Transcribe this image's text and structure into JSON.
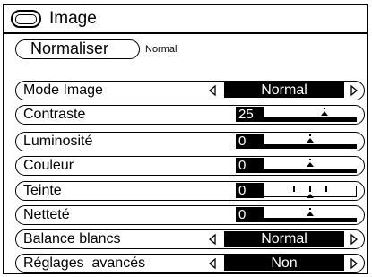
{
  "title": {
    "label": "Image",
    "icon": "screen-icon"
  },
  "normalize": {
    "button_label": "Normaliser",
    "status": "Normal"
  },
  "rows": {
    "mode_image": {
      "label": "Mode Image",
      "value": "Normal"
    },
    "contraste": {
      "label": "Contraste",
      "value": "25",
      "level": 0.65
    },
    "luminosite": {
      "label": "Luminosité",
      "value": "0",
      "level": 0.5
    },
    "couleur": {
      "label": "Couleur",
      "value": "0",
      "level": 0.5
    },
    "teinte": {
      "label": "Teinte",
      "value": "0",
      "level": 0.5
    },
    "nettete": {
      "label": "Netteté",
      "value": "0",
      "level": 0.5
    },
    "balance_blancs": {
      "label": "Balance blancs",
      "value": "Normal"
    },
    "reglages_avances": {
      "label": "Réglages  avancés",
      "value": "Non"
    }
  }
}
